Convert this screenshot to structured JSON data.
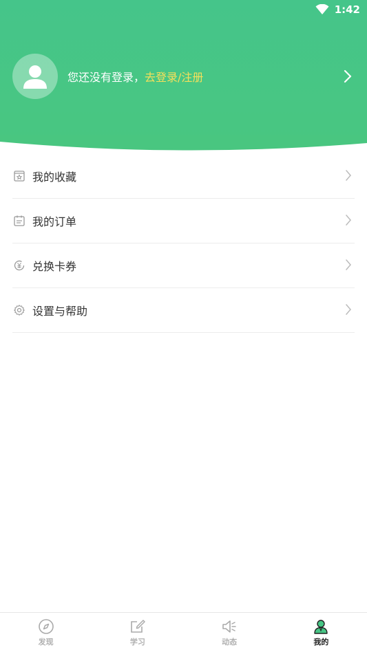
{
  "status": {
    "time": "1:42"
  },
  "profile": {
    "prompt": "您还没有登录，",
    "login_link": "去登录/注册"
  },
  "menu": [
    {
      "label": "我的收藏",
      "icon": "favorites-icon"
    },
    {
      "label": "我的订单",
      "icon": "order-icon"
    },
    {
      "label": "兑换卡券",
      "icon": "coupon-icon"
    },
    {
      "label": "设置与帮助",
      "icon": "settings-icon"
    }
  ],
  "nav": [
    {
      "label": "发现",
      "icon": "compass-icon",
      "active": false
    },
    {
      "label": "学习",
      "icon": "edit-icon",
      "active": false
    },
    {
      "label": "动态",
      "icon": "speaker-icon",
      "active": false
    },
    {
      "label": "我的",
      "icon": "user-icon",
      "active": true
    }
  ],
  "colors": {
    "brand": "#47c585",
    "link": "#f6e05a",
    "text": "#333333",
    "inactive": "#b0b0b0"
  }
}
